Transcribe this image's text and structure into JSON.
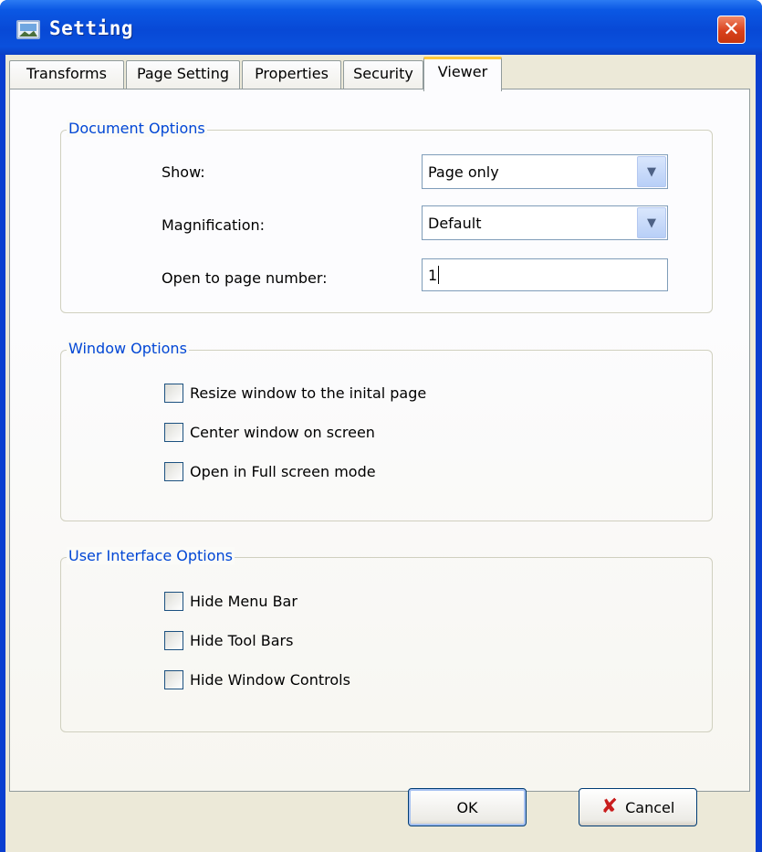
{
  "window": {
    "title": "Setting",
    "icon": "picture-icon",
    "close_icon": "close-icon"
  },
  "tabs": [
    {
      "label": "Transforms",
      "active": false
    },
    {
      "label": "Page Setting",
      "active": false
    },
    {
      "label": "Properties",
      "active": false
    },
    {
      "label": "Security",
      "active": false
    },
    {
      "label": "Viewer",
      "active": true
    }
  ],
  "document_options": {
    "legend": "Document Options",
    "show_label": "Show:",
    "show_value": "Page only",
    "magnification_label": "Magnification:",
    "magnification_value": "Default",
    "page_number_label": "Open to page number:",
    "page_number_value": "1"
  },
  "window_options": {
    "legend": "Window Options",
    "checkboxes": [
      {
        "label": "Resize window to the inital page",
        "checked": false
      },
      {
        "label": "Center window on screen",
        "checked": false
      },
      {
        "label": "Open in Full screen mode",
        "checked": false
      }
    ]
  },
  "ui_options": {
    "legend": "User Interface Options",
    "checkboxes": [
      {
        "label": "Hide Menu Bar",
        "checked": false
      },
      {
        "label": "Hide Tool Bars",
        "checked": false
      },
      {
        "label": "Hide Window Controls",
        "checked": false
      }
    ]
  },
  "buttons": {
    "ok": "OK",
    "cancel": "Cancel",
    "cancel_icon": "x-icon"
  },
  "colors": {
    "title_bar": "#0a50dc",
    "legend_text": "#0046d5",
    "close_button": "#d9411c",
    "cancel_icon": "#c91d1d"
  }
}
